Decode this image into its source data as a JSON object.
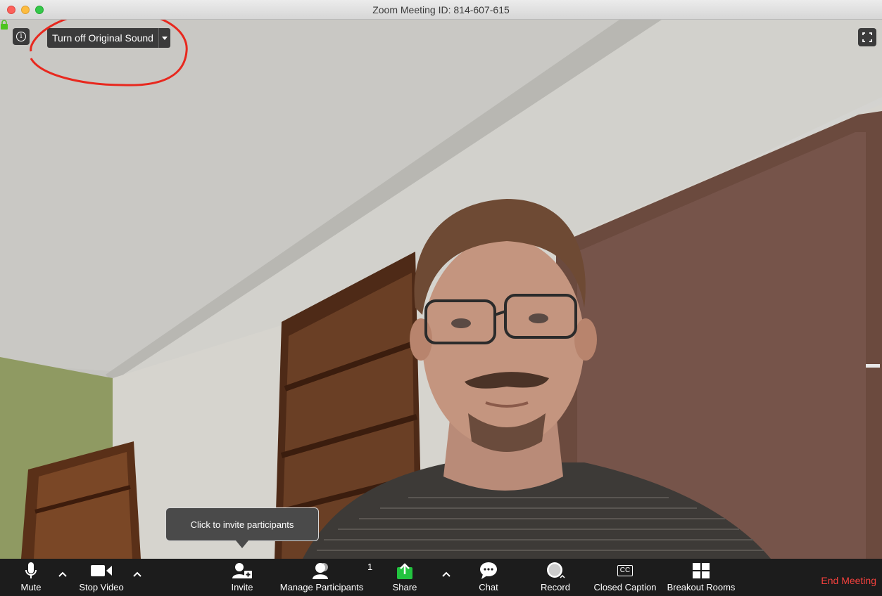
{
  "window": {
    "title": "Zoom Meeting ID: 814-607-615"
  },
  "overlay": {
    "info_icon_glyph": "i",
    "sound_button_label": "Turn off Original Sound"
  },
  "tooltip": {
    "text": "Click to invite participants"
  },
  "toolbar": {
    "mute": "Mute",
    "stop_video": "Stop Video",
    "invite": "Invite",
    "manage_participants": "Manage Participants",
    "participant_count": "1",
    "share": "Share",
    "chat": "Chat",
    "record": "Record",
    "closed_caption": "Closed Caption",
    "cc_glyph": "CC",
    "breakout_rooms": "Breakout Rooms",
    "end_meeting": "End Meeting"
  },
  "colors": {
    "end_meeting": "#f4413d",
    "share_green": "#22c33f",
    "annotation_red": "#e8281e"
  }
}
